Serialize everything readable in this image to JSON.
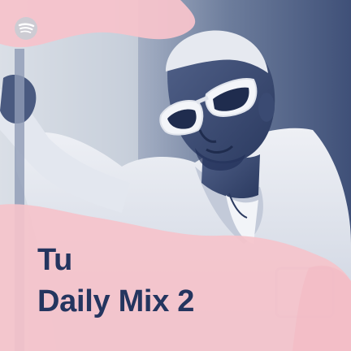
{
  "playlist": {
    "title_line_1": "Tu",
    "title_line_2": "Daily Mix 2"
  },
  "icons": {
    "brand": "spotify-logo-icon",
    "artwork": "artist-portrait"
  },
  "colors": {
    "overlay_pink": "#f5c3cb",
    "duotone_dark": "#2c3c62",
    "duotone_light": "#e8ebf2",
    "title_text": "#24355f"
  }
}
